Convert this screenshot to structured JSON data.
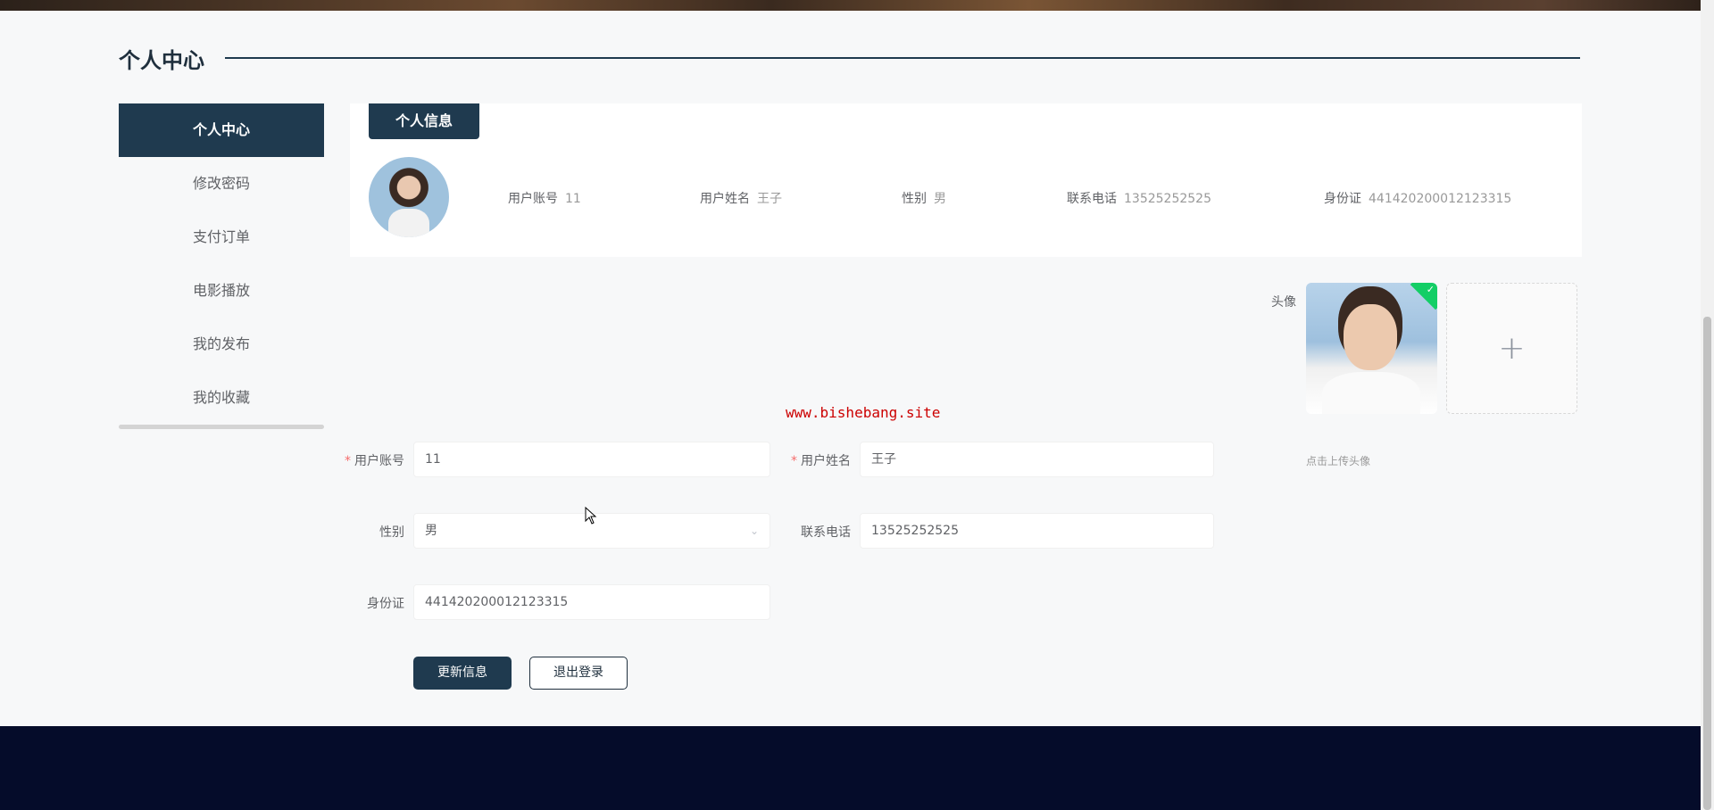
{
  "page": {
    "title": "个人中心"
  },
  "sidebar": {
    "items": [
      {
        "label": "个人中心",
        "active": true
      },
      {
        "label": "修改密码",
        "active": false
      },
      {
        "label": "支付订单",
        "active": false
      },
      {
        "label": "电影播放",
        "active": false
      },
      {
        "label": "我的发布",
        "active": false
      },
      {
        "label": "我的收藏",
        "active": false
      }
    ]
  },
  "info": {
    "tab_label": "个人信息",
    "fields": [
      {
        "label": "用户账号",
        "value": "11"
      },
      {
        "label": "用户姓名",
        "value": "王子"
      },
      {
        "label": "性别",
        "value": "男"
      },
      {
        "label": "联系电话",
        "value": "13525252525"
      },
      {
        "label": "身份证",
        "value": "441420200012123315"
      }
    ]
  },
  "avatar": {
    "label": "头像",
    "upload_tip": "点击上传头像",
    "uploaded": true
  },
  "watermark": "www.bishebang.site",
  "form": {
    "account": {
      "label": "用户账号",
      "required": true,
      "value": "11"
    },
    "name": {
      "label": "用户姓名",
      "required": true,
      "value": "王子"
    },
    "gender": {
      "label": "性别",
      "value": "男"
    },
    "phone": {
      "label": "联系电话",
      "value": "13525252525"
    },
    "idcard": {
      "label": "身份证",
      "value": "441420200012123315"
    }
  },
  "buttons": {
    "update": "更新信息",
    "logout": "退出登录"
  },
  "colors": {
    "primary": "#1f3a4f",
    "footer": "#050c2a",
    "success": "#13ce66",
    "required": "#f56c6c"
  }
}
